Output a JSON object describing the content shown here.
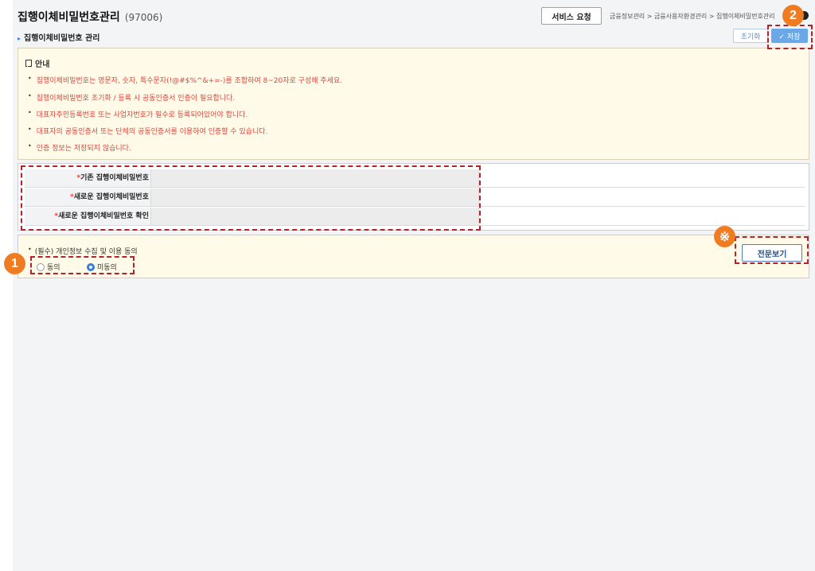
{
  "header": {
    "title": "집행이체비밀번호관리",
    "code": "(97006)",
    "service_button": "서비스 요청",
    "breadcrumb": "금융정보관리 > 금융사용자환경관리 > 집행이체비밀번호관리"
  },
  "section": {
    "subtitle": "집행이체비밀번호 관리",
    "reset_label": "초기화",
    "save_label": "✓ 저장"
  },
  "notice": {
    "heading": "안내",
    "lines": [
      "집행이체비밀번호는 영문자, 숫자, 특수문자(!@#$%^&+=-)를 조합하여 8~20자로 구성해 주세요.",
      "집행이체비밀번호 초기화 / 등록 시 공동인증서 인증이 필요합니다.",
      "대표자주민등록번호 또는 사업자번호가 필수로 등록되어있어야 합니다.",
      "대표자의 공동인증서 또는 단체의 공동인증서를 이용하여 인증할 수 있습니다.",
      "인증 정보는 저장되지 않습니다."
    ]
  },
  "form": {
    "required_mark": "*",
    "fields": [
      "기존 집행이체비밀번호",
      "새로운 집행이체비밀번호",
      "새로운 집행이체비밀번호 확인"
    ]
  },
  "consent": {
    "title": "(필수) 개인정보 수집 및 이용 동의",
    "agree_label": "동의",
    "disagree_label": "미동의",
    "selected": "미동의",
    "full_view_button": "전문보기"
  },
  "annotations": {
    "badge1": "1",
    "badge2": "2",
    "badge_note": "※"
  },
  "colors": {
    "badge": "#f07c22",
    "dash": "#b4232c",
    "notice_text": "#d9463e",
    "save_button": "#6aa8e8"
  }
}
